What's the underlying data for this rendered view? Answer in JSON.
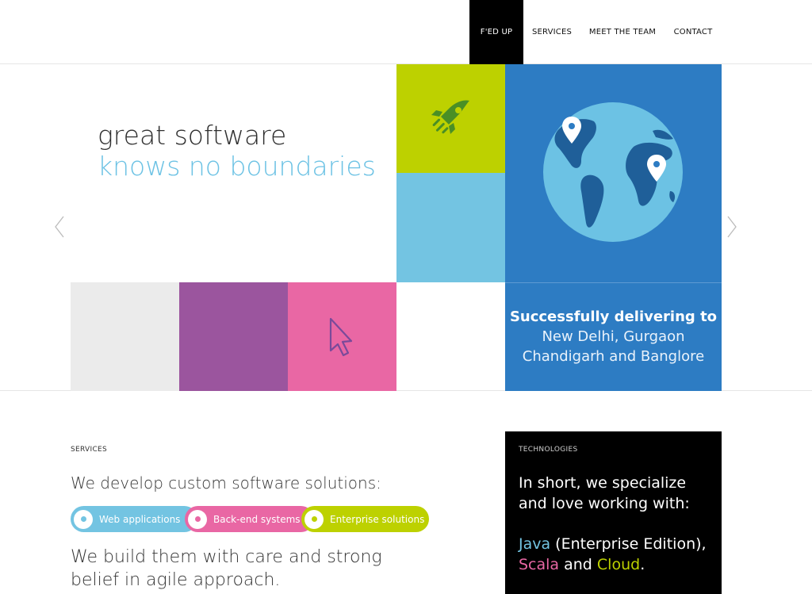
{
  "nav": {
    "items": [
      {
        "label": "F'ED UP",
        "active": true
      },
      {
        "label": "SERVICES",
        "active": false
      },
      {
        "label": "MEET THE TEAM",
        "active": false
      },
      {
        "label": "CONTACT",
        "active": false
      }
    ]
  },
  "hero": {
    "title_line1": "great software",
    "title_line2": "knows no boundaries",
    "delivering_title": "Successfully delivering to",
    "delivering_line1": "New Delhi, Gurgaon",
    "delivering_line2": "Chandigarh and Banglore",
    "icons": [
      "rocket-icon",
      "globe-icon",
      "map-pin-icon",
      "cursor-icon",
      "chevron-left-icon",
      "chevron-right-icon"
    ],
    "colors": {
      "green": "#bdd100",
      "sky": "#73c4e2",
      "blue": "#2d7cc3",
      "grey": "#ebebeb",
      "purple": "#9b559e",
      "pink": "#e967a4"
    }
  },
  "services": {
    "label": "SERVICES",
    "heading": "We develop custom software solutions:",
    "pills": [
      {
        "label": "Web applications",
        "color": "#73c4e2"
      },
      {
        "label": "Back-end systems",
        "color": "#e967a4"
      },
      {
        "label": "Enterprise solutions",
        "color": "#bdd100"
      }
    ],
    "body": "We build them with care and strong belief in agile approach."
  },
  "technologies": {
    "label": "TECHNOLOGIES",
    "intro": "In short, we specialize and love working with:",
    "java": "Java",
    "java_suffix": " (Enterprise Edition),",
    "scala": "Scala",
    "and": " and ",
    "cloud": "Cloud",
    "period": "."
  }
}
